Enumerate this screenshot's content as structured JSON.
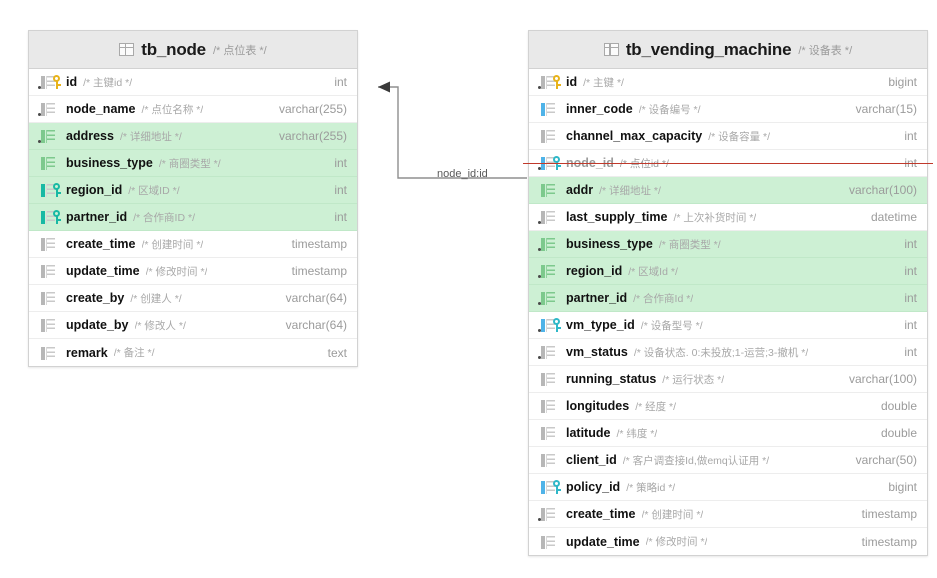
{
  "diagram": {
    "type": "er-diagram",
    "background": "#ffffff"
  },
  "relationship": {
    "label": "node_id:id",
    "from_table": "tb_vending_machine",
    "from_column": "node_id",
    "to_table": "tb_node",
    "to_column": "id",
    "line_color": "#8f8f8f"
  },
  "colors": {
    "highlight_green": "#cdf0d4",
    "header_gray": "#e9e9e9",
    "strike_red": "#c0392b",
    "pk_key": "#e8b31b",
    "fk_key": "#2fb8c8",
    "type_text": "#9b9b9b",
    "comment_text": "#a8a8a8"
  },
  "tables": [
    {
      "name": "tb_node",
      "comment": "/* 点位表 */",
      "icon": "table-icon",
      "columns": [
        {
          "name": "id",
          "comment": "/* 主键id */",
          "type": "int",
          "key": "pk",
          "bar": "gray",
          "dot": true,
          "highlight": false,
          "struck": false
        },
        {
          "name": "node_name",
          "comment": "/* 点位名称 */",
          "type": "varchar(255)",
          "key": "",
          "bar": "gray",
          "dot": true,
          "highlight": false,
          "struck": false
        },
        {
          "name": "address",
          "comment": "/* 详细地址 */",
          "type": "varchar(255)",
          "key": "",
          "bar": "green",
          "dot": true,
          "highlight": true,
          "struck": false
        },
        {
          "name": "business_type",
          "comment": "/* 商圈类型 */",
          "type": "int",
          "key": "",
          "bar": "green",
          "dot": false,
          "highlight": true,
          "struck": false
        },
        {
          "name": "region_id",
          "comment": "/* 区域ID */",
          "type": "int",
          "key": "fk-green",
          "bar": "teal",
          "dot": false,
          "highlight": true,
          "struck": false
        },
        {
          "name": "partner_id",
          "comment": "/* 合作商ID */",
          "type": "int",
          "key": "fk-green",
          "bar": "teal",
          "dot": false,
          "highlight": true,
          "struck": false
        },
        {
          "name": "create_time",
          "comment": "/* 创建时间 */",
          "type": "timestamp",
          "key": "",
          "bar": "gray",
          "dot": false,
          "highlight": false,
          "struck": false
        },
        {
          "name": "update_time",
          "comment": "/* 修改时间 */",
          "type": "timestamp",
          "key": "",
          "bar": "gray",
          "dot": false,
          "highlight": false,
          "struck": false
        },
        {
          "name": "create_by",
          "comment": "/* 创建人 */",
          "type": "varchar(64)",
          "key": "",
          "bar": "gray",
          "dot": false,
          "highlight": false,
          "struck": false
        },
        {
          "name": "update_by",
          "comment": "/* 修改人 */",
          "type": "varchar(64)",
          "key": "",
          "bar": "gray",
          "dot": false,
          "highlight": false,
          "struck": false
        },
        {
          "name": "remark",
          "comment": "/* 备注 */",
          "type": "text",
          "key": "",
          "bar": "gray",
          "dot": false,
          "highlight": false,
          "struck": false
        }
      ]
    },
    {
      "name": "tb_vending_machine",
      "comment": "/* 设备表 */",
      "icon": "table-icon",
      "columns": [
        {
          "name": "id",
          "comment": "/* 主键 */",
          "type": "bigint",
          "key": "pk",
          "bar": "gray",
          "dot": true,
          "highlight": false,
          "struck": false
        },
        {
          "name": "inner_code",
          "comment": "/* 设备编号 */",
          "type": "varchar(15)",
          "key": "",
          "bar": "blue",
          "dot": false,
          "highlight": false,
          "struck": false
        },
        {
          "name": "channel_max_capacity",
          "comment": "/* 设备容量 */",
          "type": "int",
          "key": "",
          "bar": "gray",
          "dot": false,
          "highlight": false,
          "struck": false
        },
        {
          "name": "node_id",
          "comment": "/* 点位id */",
          "type": "int",
          "key": "fk",
          "bar": "blue",
          "dot": true,
          "highlight": false,
          "struck": true
        },
        {
          "name": "addr",
          "comment": "/* 详细地址 */",
          "type": "varchar(100)",
          "key": "",
          "bar": "green",
          "dot": false,
          "highlight": true,
          "struck": false
        },
        {
          "name": "last_supply_time",
          "comment": "/* 上次补货时间 */",
          "type": "datetime",
          "key": "",
          "bar": "gray",
          "dot": true,
          "highlight": false,
          "struck": false
        },
        {
          "name": "business_type",
          "comment": "/* 商圈类型 */",
          "type": "int",
          "key": "",
          "bar": "green",
          "dot": true,
          "highlight": true,
          "struck": false
        },
        {
          "name": "region_id",
          "comment": "/* 区域Id */",
          "type": "int",
          "key": "",
          "bar": "green",
          "dot": true,
          "highlight": true,
          "struck": false
        },
        {
          "name": "partner_id",
          "comment": "/* 合作商Id */",
          "type": "int",
          "key": "",
          "bar": "green",
          "dot": true,
          "highlight": true,
          "struck": false
        },
        {
          "name": "vm_type_id",
          "comment": "/* 设备型号 */",
          "type": "int",
          "key": "fk",
          "bar": "blue",
          "dot": true,
          "highlight": false,
          "struck": false
        },
        {
          "name": "vm_status",
          "comment": "/* 设备状态. 0:未投放;1-运营;3-撤机 */",
          "type": "int",
          "key": "",
          "bar": "gray",
          "dot": true,
          "highlight": false,
          "struck": false
        },
        {
          "name": "running_status",
          "comment": "/* 运行状态 */",
          "type": "varchar(100)",
          "key": "",
          "bar": "gray",
          "dot": false,
          "highlight": false,
          "struck": false
        },
        {
          "name": "longitudes",
          "comment": "/* 经度 */",
          "type": "double",
          "key": "",
          "bar": "gray",
          "dot": false,
          "highlight": false,
          "struck": false
        },
        {
          "name": "latitude",
          "comment": "/* 纬度 */",
          "type": "double",
          "key": "",
          "bar": "gray",
          "dot": false,
          "highlight": false,
          "struck": false
        },
        {
          "name": "client_id",
          "comment": "/* 客户调查接Id,做emq认证用 */",
          "type": "varchar(50)",
          "key": "",
          "bar": "gray",
          "dot": false,
          "highlight": false,
          "struck": false
        },
        {
          "name": "policy_id",
          "comment": "/* 策略id */",
          "type": "bigint",
          "key": "fk",
          "bar": "blue",
          "dot": false,
          "highlight": false,
          "struck": false
        },
        {
          "name": "create_time",
          "comment": "/* 创建时间 */",
          "type": "timestamp",
          "key": "",
          "bar": "gray",
          "dot": true,
          "highlight": false,
          "struck": false
        },
        {
          "name": "update_time",
          "comment": "/* 修改时间 */",
          "type": "timestamp",
          "key": "",
          "bar": "gray",
          "dot": false,
          "highlight": false,
          "struck": false
        }
      ]
    }
  ]
}
